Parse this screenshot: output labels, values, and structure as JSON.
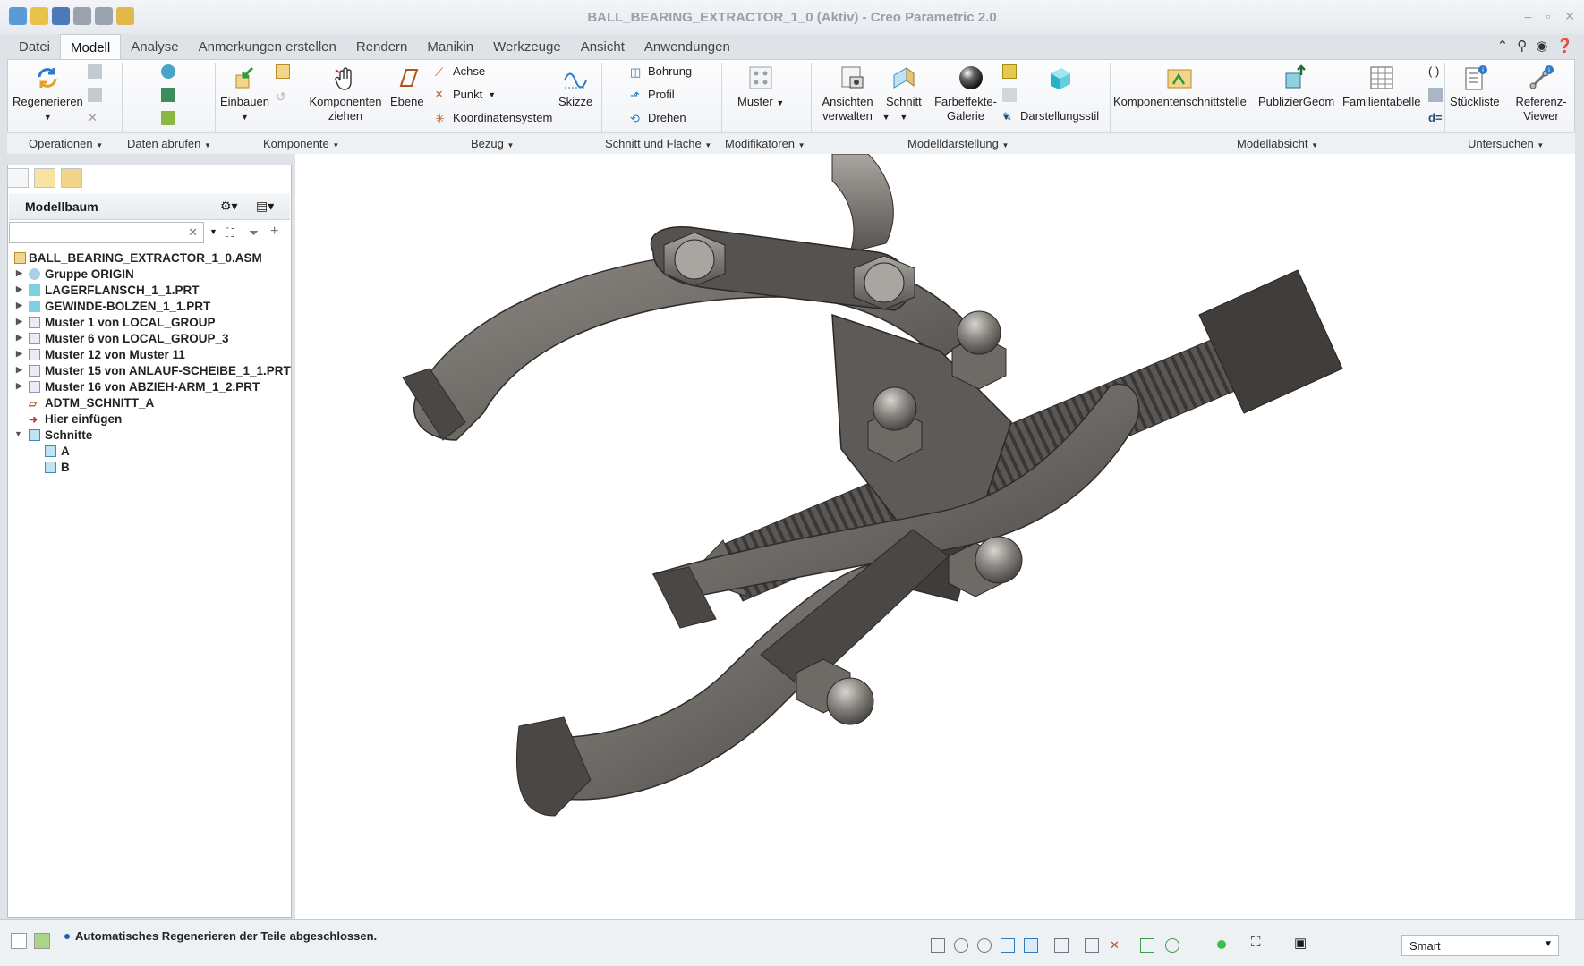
{
  "window": {
    "title": "BALL_BEARING_EXTRACTOR_1_0 (Aktiv) - Creo Parametric 2.0",
    "controls": [
      "–",
      "▫",
      "✕"
    ]
  },
  "tabs": [
    "Datei",
    "Modell",
    "Analyse",
    "Anmerkungen erstellen",
    "Rendern",
    "Manikin",
    "Werkzeuge",
    "Ansicht",
    "Anwendungen"
  ],
  "ribbon": {
    "buttons": {
      "regenerieren": "Regenerieren",
      "einbauen": "Einbauen",
      "komponenten_ziehen": "Komponenten ziehen",
      "ebene": "Ebene",
      "achse": "Achse",
      "punkt": "Punkt",
      "koordinatensystem": "Koordinatensystem",
      "skizze": "Skizze",
      "bohrung": "Bohrung",
      "profil": "Profil",
      "drehen": "Drehen",
      "muster": "Muster",
      "ansichten_verwalten": "Ansichten verwalten",
      "schnitt": "Schnitt",
      "farbeffekte": "Farbeffekte-Galerie",
      "darstellungsstil": "Darstellungsstil",
      "komponentenschnittstelle": "Komponentenschnittstelle",
      "publiziergeom": "PublizierGeom",
      "familientabelle": "Familientabelle",
      "stueckliste": "Stückliste",
      "referenzviewer": "Referenz-Viewer"
    },
    "groups": [
      "Operationen",
      "Daten abrufen",
      "Komponente",
      "Bezug",
      "Schnitt und Fläche",
      "Modifikatoren",
      "Modelldarstellung",
      "Modellabsicht",
      "Untersuchen"
    ]
  },
  "model_tree": {
    "title": "Modellbaum",
    "search_placeholder": "",
    "items": [
      {
        "label": "BALL_BEARING_EXTRACTOR_1_0.ASM"
      },
      {
        "label": "Gruppe ORIGIN"
      },
      {
        "label": "LAGERFLANSCH_1_1.PRT"
      },
      {
        "label": "GEWINDE-BOLZEN_1_1.PRT"
      },
      {
        "label": "Muster 1 von LOCAL_GROUP"
      },
      {
        "label": "Muster 6 von LOCAL_GROUP_3"
      },
      {
        "label": "Muster 12 von Muster 11"
      },
      {
        "label": "Muster 15 von ANLAUF-SCHEIBE_1_1.PRT"
      },
      {
        "label": "Muster 16 von ABZIEH-ARM_1_2.PRT"
      },
      {
        "label": "ADTM_SCHNITT_A"
      },
      {
        "label": "Hier einfügen"
      },
      {
        "label": "Schnitte"
      },
      {
        "label": "A"
      },
      {
        "label": "B"
      }
    ]
  },
  "status": {
    "message": "Automatisches Regenerieren der Teile abgeschlossen.",
    "filter": "Smart"
  },
  "colors": {
    "metal": "#6e6a66",
    "metal_light": "#a9a5a0",
    "metal_dark": "#3f3c39"
  }
}
